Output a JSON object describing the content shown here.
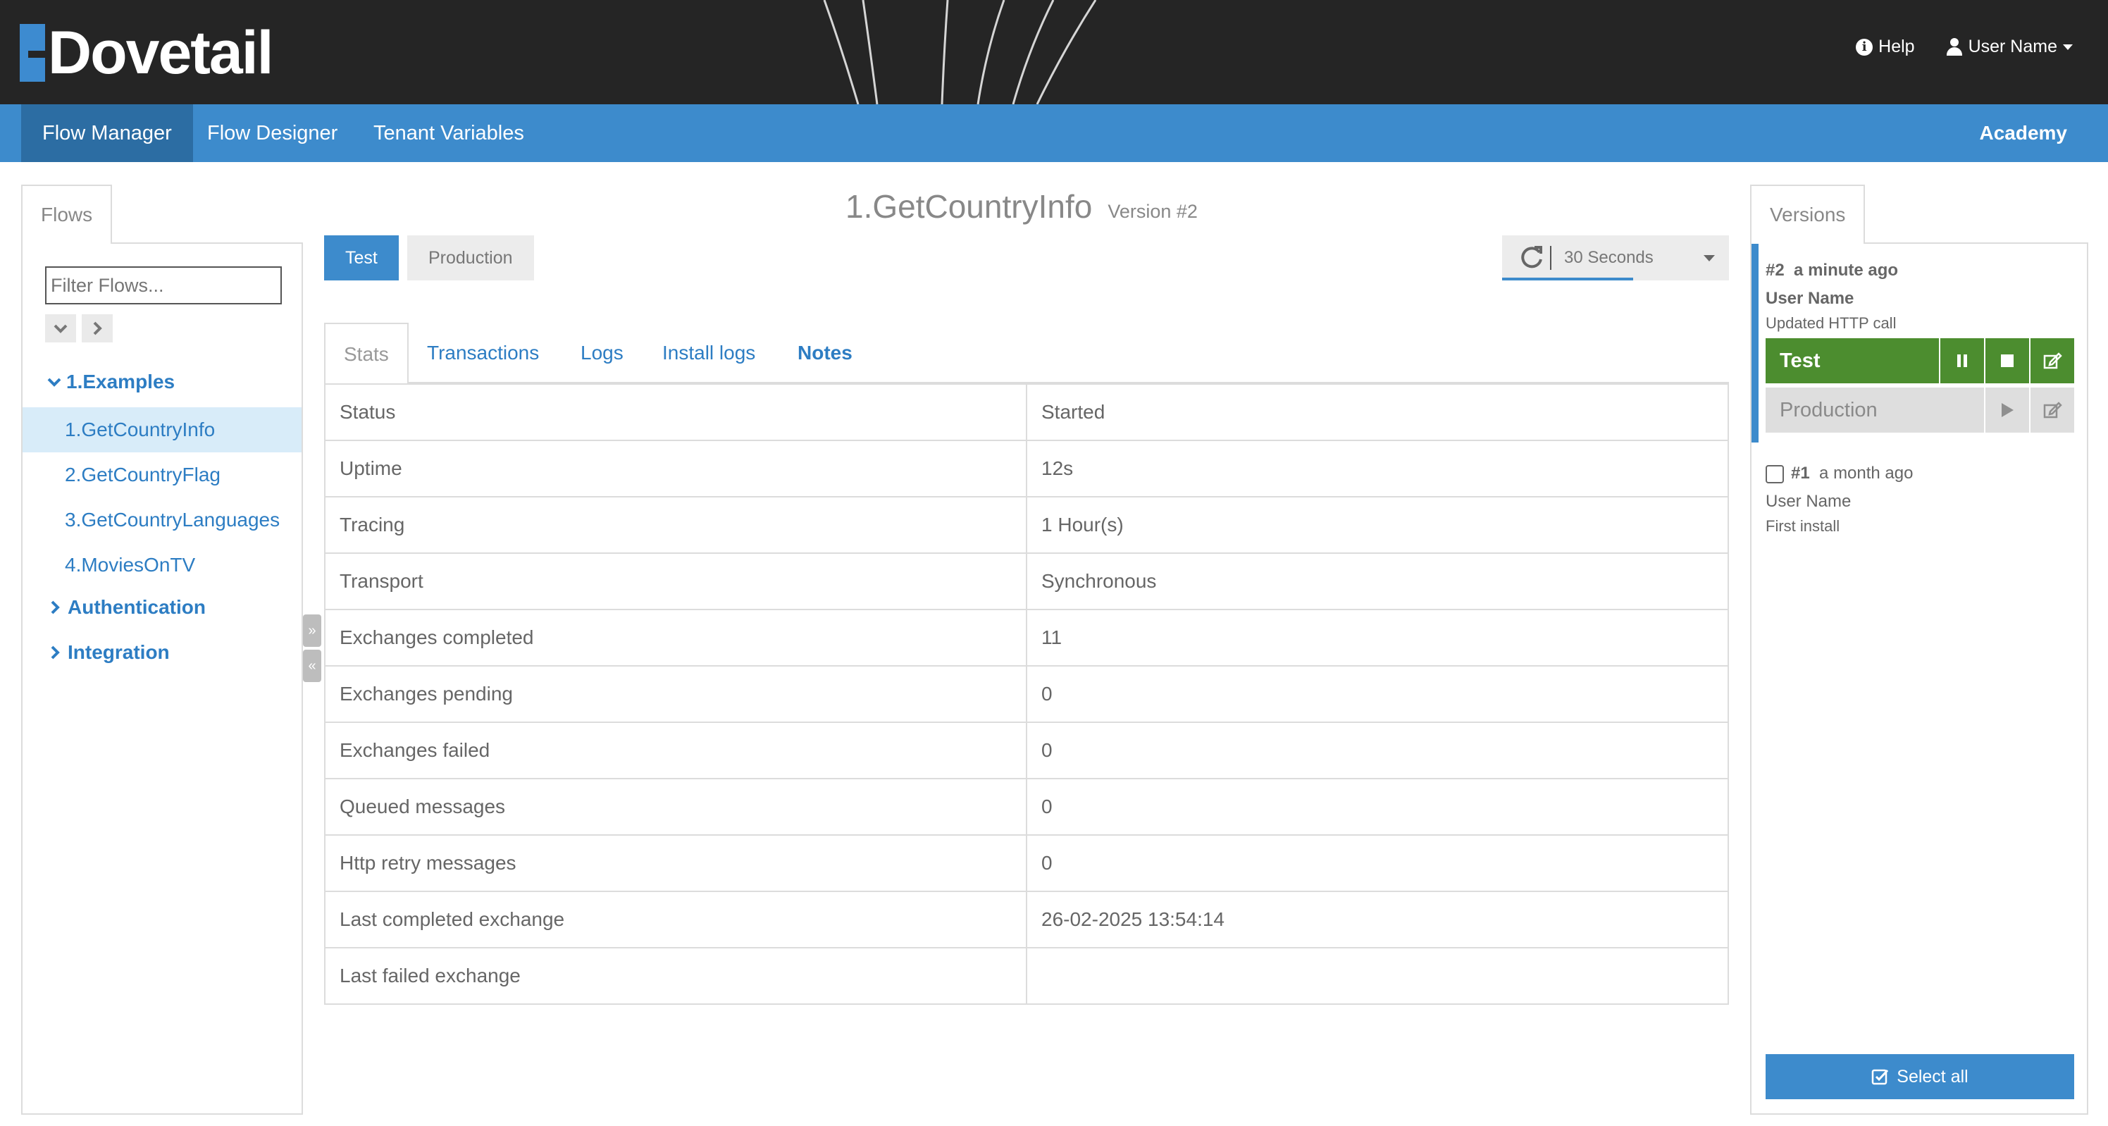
{
  "app": {
    "logo_text": "Dovetail",
    "help_label": "Help",
    "user_label": "User Name"
  },
  "nav": {
    "items": [
      {
        "label": "Flow Manager",
        "active": true
      },
      {
        "label": "Flow Designer",
        "active": false
      },
      {
        "label": "Tenant Variables",
        "active": false
      }
    ],
    "academy": "Academy"
  },
  "sidebar": {
    "tab_label": "Flows",
    "filter_placeholder": "Filter Flows...",
    "groups": [
      {
        "label": "1.Examples",
        "expanded": true,
        "items": [
          "1.GetCountryInfo",
          "2.GetCountryFlag",
          "3.GetCountryLanguages",
          "4.MoviesOnTV"
        ],
        "selected": "1.GetCountryInfo"
      },
      {
        "label": "Authentication",
        "expanded": false
      },
      {
        "label": "Integration",
        "expanded": false
      }
    ]
  },
  "main": {
    "title": "1.GetCountryInfo",
    "version": "Version #2",
    "env_buttons": [
      "Test",
      "Production"
    ],
    "active_env": "Test",
    "refresh_interval": "30 Seconds",
    "tabs": [
      "Stats",
      "Transactions",
      "Logs",
      "Install logs",
      "Notes"
    ],
    "active_tab": "Stats",
    "stats": [
      {
        "label": "Status",
        "value": "Started"
      },
      {
        "label": "Uptime",
        "value": "12s"
      },
      {
        "label": "Tracing",
        "value": "1 Hour(s)"
      },
      {
        "label": "Transport",
        "value": "Synchronous"
      },
      {
        "label": "Exchanges completed",
        "value": "11"
      },
      {
        "label": "Exchanges pending",
        "value": "0"
      },
      {
        "label": "Exchanges failed",
        "value": "0"
      },
      {
        "label": "Queued messages",
        "value": "0"
      },
      {
        "label": "Http retry messages",
        "value": "0"
      },
      {
        "label": "Last completed exchange",
        "value": "26-02-2025 13:54:14"
      },
      {
        "label": "Last failed exchange",
        "value": ""
      }
    ]
  },
  "versions": {
    "tab_label": "Versions",
    "items": [
      {
        "number": "#2",
        "time": "a minute ago",
        "user": "User Name",
        "note": "Updated HTTP call",
        "envs": [
          {
            "name": "Test",
            "state": "running"
          },
          {
            "name": "Production",
            "state": "stopped"
          }
        ]
      },
      {
        "number": "#1",
        "time": "a month ago",
        "user": "User Name",
        "note": "First install"
      }
    ],
    "select_all": "Select all"
  },
  "colors": {
    "header_bg": "#252525",
    "nav_bg": "#3d8bcc",
    "nav_active": "#2c6da3",
    "link": "#2d7dc3",
    "test_green": "#4c8d2f",
    "selected_row": "#d8ecf9"
  }
}
